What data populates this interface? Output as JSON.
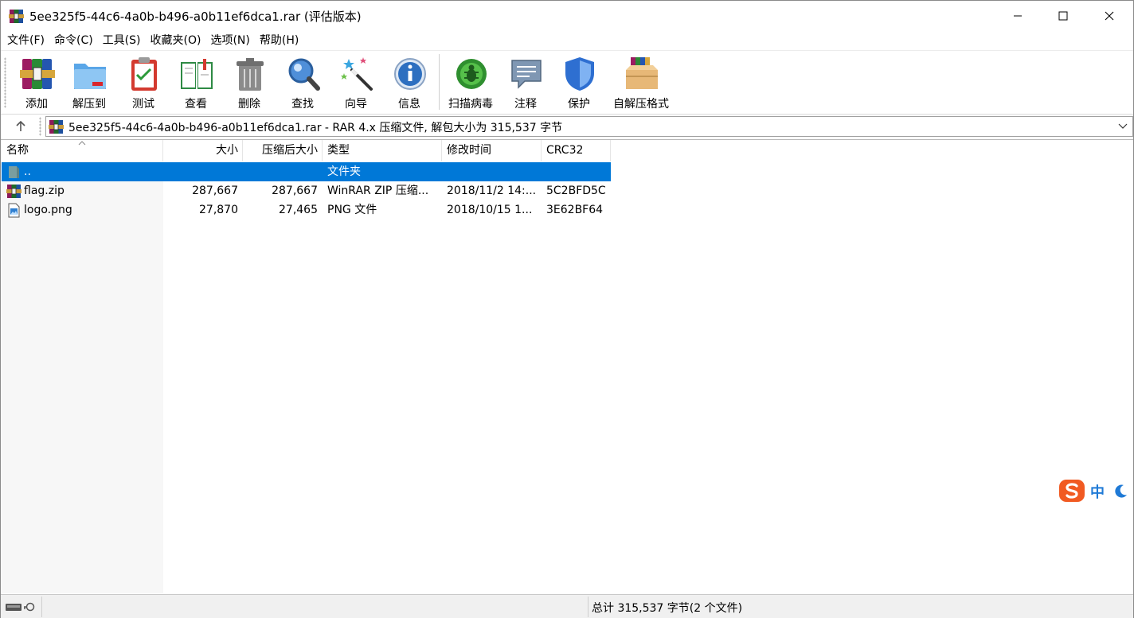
{
  "window": {
    "title": "5ee325f5-44c6-4a0b-b496-a0b11ef6dca1.rar (评估版本)"
  },
  "menu": [
    "文件(F)",
    "命令(C)",
    "工具(S)",
    "收藏夹(O)",
    "选项(N)",
    "帮助(H)"
  ],
  "toolbar": {
    "add": "添加",
    "extract_to": "解压到",
    "test": "测试",
    "view": "查看",
    "delete": "删除",
    "find": "查找",
    "wizard": "向导",
    "info": "信息",
    "scan_virus": "扫描病毒",
    "comment": "注释",
    "protect": "保护",
    "sfx": "自解压格式"
  },
  "path": {
    "text": "5ee325f5-44c6-4a0b-b496-a0b11ef6dca1.rar - RAR 4.x 压缩文件, 解包大小为 315,537 字节"
  },
  "columns": {
    "name": "名称",
    "size": "大小",
    "packed": "压缩后大小",
    "type": "类型",
    "mtime": "修改时间",
    "crc": "CRC32"
  },
  "rows": [
    {
      "name": "..",
      "size": "",
      "packed": "",
      "type": "文件夹",
      "mtime": "",
      "crc": "",
      "icon": "parent-folder-icon",
      "selected": true
    },
    {
      "name": "flag.zip",
      "size": "287,667",
      "packed": "287,667",
      "type": "WinRAR ZIP 压缩...",
      "mtime": "2018/11/2 14:...",
      "crc": "5C2BFD5C",
      "icon": "zip-archive-icon",
      "selected": false
    },
    {
      "name": "logo.png",
      "size": "27,870",
      "packed": "27,465",
      "type": "PNG 文件",
      "mtime": "2018/10/15 1...",
      "crc": "3E62BF64",
      "icon": "image-file-icon",
      "selected": false
    }
  ],
  "status": {
    "summary": "总计 315,537 字节(2 个文件)"
  },
  "ime": {
    "mode": "中"
  },
  "colors": {
    "selection": "#0078d7",
    "ime_brand": "#f15a22",
    "ime_accent": "#1f7ad6"
  }
}
